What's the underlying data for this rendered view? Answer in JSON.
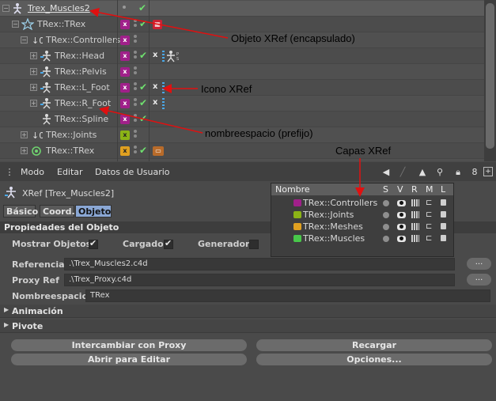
{
  "object_manager": {
    "rows": [
      {
        "name": "Trex_Muscles2",
        "top": true
      },
      {
        "name": "TRex::TRex"
      },
      {
        "name": "TRex::Controllers"
      },
      {
        "name": "TRex::Head"
      },
      {
        "name": "TRex::Pelvis"
      },
      {
        "name": "TRex::L_Foot"
      },
      {
        "name": "TRex::R_Foot"
      },
      {
        "name": "TRex::Spline"
      },
      {
        "name": "TRex::Joints"
      },
      {
        "name": "TRex::TRex"
      }
    ]
  },
  "annotations": {
    "objeto_xref": "Objeto XRef (encapsulado)",
    "icono_xref": "Icono XRef",
    "nombreespacio": "nombreespacio (prefijo)",
    "capas_xref": "Capas XRef",
    "arrow_color": "#e01010"
  },
  "attribute_manager": {
    "menu": [
      "Modo",
      "Editar",
      "Datos de Usuario"
    ],
    "title": "XRef [Trex_Muscles2]",
    "tabs": [
      "Básico",
      "Coord.",
      "Objeto"
    ],
    "active_tab": "Objeto",
    "section_title": "Propiedades del Objeto",
    "checks": {
      "mostrar_objetos": "Mostrar Objetos",
      "cargado": "Cargado",
      "generador": "Generador"
    },
    "referencia_label": "Referencia",
    "referencia_value": ".\\Trex_Muscles2.c4d",
    "proxy_label": "Proxy Ref",
    "proxy_value": ".\\Trex_Proxy.c4d",
    "nombreespacio_label": "Nombreespacio",
    "nombreespacio_value": "TRex",
    "dots_label": "...",
    "animacion": "Animación",
    "pivote": "Pivote",
    "buttons": {
      "intercambiar": "Intercambiar con Proxy",
      "recargar": "Recargar",
      "abrir": "Abrir para Editar",
      "opciones": "Opciones..."
    }
  },
  "layers": {
    "headers": {
      "nombre": "Nombre",
      "s": "S",
      "v": "V",
      "r": "R",
      "m": "M",
      "l": "L"
    },
    "items": [
      {
        "name": "TRex::Controllers",
        "color": "#a0208a"
      },
      {
        "name": "TRex::Joints",
        "color": "#8bb316"
      },
      {
        "name": "TRex::Meshes",
        "color": "#e0a020"
      },
      {
        "name": "TRex::Muscles",
        "color": "#48c84a"
      }
    ]
  }
}
